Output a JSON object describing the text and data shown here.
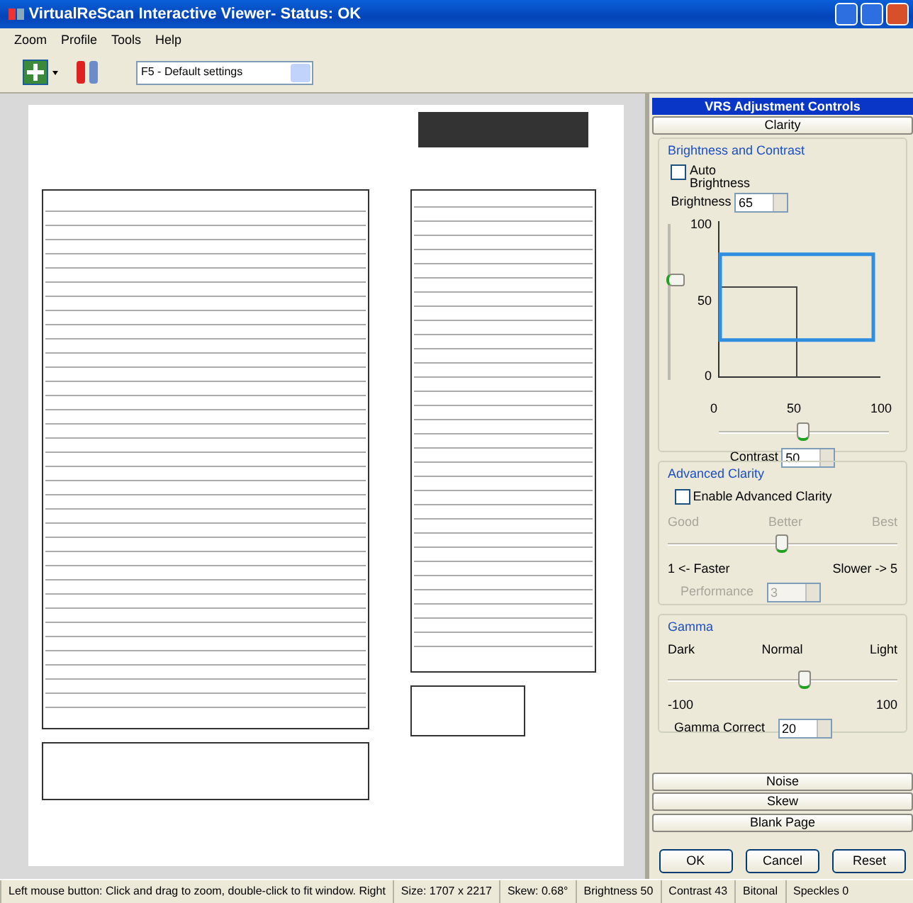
{
  "window": {
    "title": "VirtualReScan Interactive Viewer- Status: OK"
  },
  "menu": [
    "Zoom",
    "Profile",
    "Tools",
    "Help"
  ],
  "toolbar": {
    "profile": "F5 - Default settings"
  },
  "panel": {
    "title": "VRS Adjustment Controls",
    "top_tab": "Clarity",
    "bottom_tabs": [
      "Noise",
      "Skew",
      "Blank Page"
    ]
  },
  "brightness_contrast": {
    "legend": "Brightness and Contrast",
    "auto_brightness": {
      "label": "Auto Brightness",
      "checked": false
    },
    "brightness": {
      "label": "Brightness",
      "value": "65",
      "level": 0.65
    },
    "graph": {
      "y_labels": [
        "100",
        "50",
        "0"
      ],
      "x_labels": [
        "0",
        "50",
        "100"
      ]
    },
    "contrast": {
      "label": "Contrast",
      "value": "50",
      "level": 0.5
    }
  },
  "advanced_clarity": {
    "legend": "Advanced Clarity",
    "enable": {
      "label": "Enable Advanced Clarity",
      "checked": false
    },
    "scale_labels": [
      "Good",
      "Better",
      "Best"
    ],
    "level": 0.5,
    "range_labels": [
      "1 <- Faster",
      "Slower -> 5"
    ],
    "performance": {
      "label": "Performance",
      "value": "3",
      "disabled": true
    }
  },
  "gamma": {
    "legend": "Gamma",
    "scale_labels": [
      "Dark",
      "Normal",
      "Light"
    ],
    "level": 0.6,
    "range_labels": [
      "-100",
      "100"
    ],
    "correct": {
      "label": "Gamma Correct",
      "value": "20"
    }
  },
  "buttons": [
    "OK",
    "Cancel",
    "Reset"
  ],
  "status_bar": [
    "Left mouse button: Click and drag to zoom, double-click to fit window. Right",
    "Size: 1707 x 2217",
    "Skew: 0.68°",
    "Brightness 50",
    "Contrast 43",
    "Bitonal",
    "Speckles 0"
  ]
}
